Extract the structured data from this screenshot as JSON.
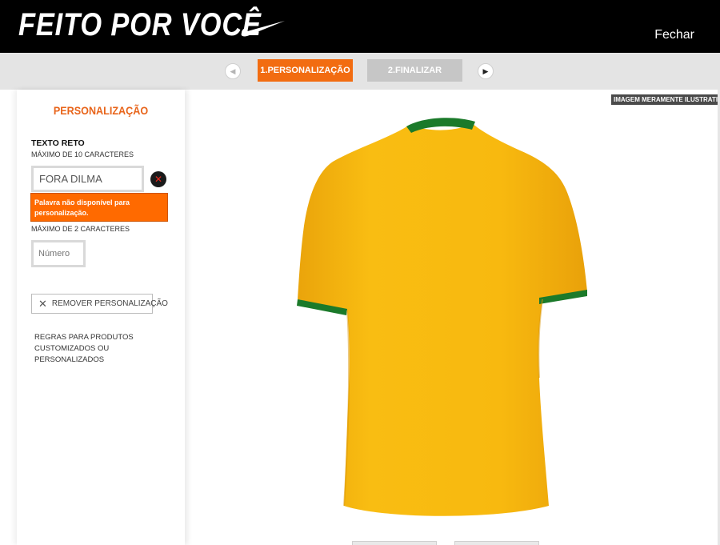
{
  "header": {
    "brand": "FEITO POR VOCÊ",
    "logo_icon": "nike-swoosh-icon",
    "close_label": "Fechar"
  },
  "steps": {
    "items": [
      {
        "label": "1.PERSONALIZAÇÃO",
        "active": true
      },
      {
        "label": "2.FINALIZAR",
        "active": false
      }
    ],
    "prev_icon": "triangle-left-icon",
    "next_icon": "triangle-right-icon"
  },
  "sidebar": {
    "title": "PERSONALIZAÇÃO",
    "text_field": {
      "label": "TEXTO RETO",
      "hint": "MÁXIMO DE 10 CARACTERES",
      "value": "FORA DILMA",
      "clear_icon": "close-icon"
    },
    "error_message": "Palavra não disponível para personalização.",
    "number_field": {
      "hint": "MÁXIMO DE 2 CARACTERES",
      "placeholder": "Número"
    },
    "remove_button": "REMOVER PERSONALIZAÇÃO",
    "rules_link": "REGRAS PARA PRODUTOS CUSTOMIZADOS OU PERSONALIZADOS"
  },
  "product": {
    "badge": "IMAGEM MERAMENTE ILUSTRATIVA"
  },
  "colors": {
    "header_bg": "#000000",
    "accent": "#f26c11",
    "error_bg": "#ff6a00",
    "jersey_yellow": "#f7b70e",
    "jersey_green": "#1b7a2a"
  }
}
